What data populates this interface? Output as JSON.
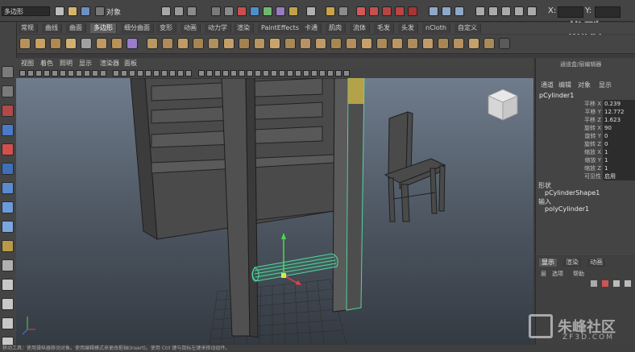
{
  "status_line": {
    "mode": "多边形",
    "object_label": "对象",
    "coord_x": "X:",
    "coord_y": "Y:"
  },
  "shelf_tabs": [
    "常规",
    "曲线",
    "曲面",
    "多边形",
    "细分曲面",
    "变形",
    "动画",
    "动力学",
    "渲染",
    "PaintEffects",
    "卡通",
    "肌肉",
    "流体",
    "毛发",
    "头发",
    "nCloth",
    "自定义"
  ],
  "active_shelf_tab": "多边形",
  "panel_menu": [
    "视图",
    "着色",
    "照明",
    "显示",
    "渲染器",
    "面板"
  ],
  "channel_box": {
    "header": "通道盒/层编辑器",
    "tabs": [
      "通道",
      "编辑",
      "对象",
      "显示"
    ],
    "object_name": "pCylinder1",
    "attributes": [
      {
        "name": "平移 X",
        "value": "0.239"
      },
      {
        "name": "平移 Y",
        "value": "12.772"
      },
      {
        "name": "平移 Z",
        "value": "1.623"
      },
      {
        "name": "旋转 X",
        "value": "90"
      },
      {
        "name": "旋转 Y",
        "value": "0"
      },
      {
        "name": "旋转 Z",
        "value": "0"
      },
      {
        "name": "缩放 X",
        "value": "1"
      },
      {
        "name": "缩放 Y",
        "value": "1"
      },
      {
        "name": "缩放 Z",
        "value": "1"
      },
      {
        "name": "可见性",
        "value": "启用"
      }
    ],
    "shapes_label": "形状",
    "shape_name": "pCylinderShape1",
    "inputs_label": "输入",
    "input_name": "polyCylinder1"
  },
  "layer_panel": {
    "tabs": [
      "显示",
      "渲染",
      "动画"
    ],
    "menu": [
      "层",
      "选项",
      "帮助"
    ]
  },
  "help_line": "移动工具：使用操纵器移动对象。使用编辑模式来更改枢轴(Insert)。使用 Ctrl 键与鼠标左键来移动组件。",
  "watermark": {
    "top_right": "优酷",
    "brand": "朱峰社区",
    "brand_url": "ZF3D.COM"
  },
  "colors": {
    "ui_bg": "#444444",
    "selection_green": "#53d6a0",
    "selection_yellow": "#c7b24a",
    "viewport_top": "#6f7c8c"
  }
}
